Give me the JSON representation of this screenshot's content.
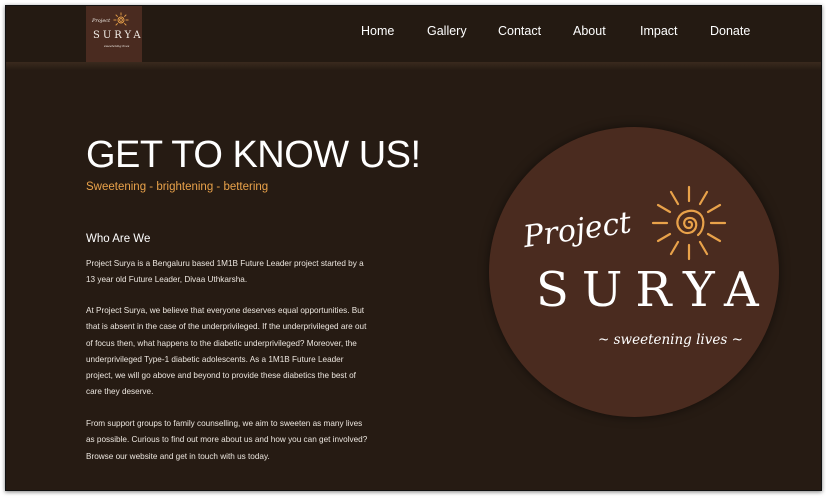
{
  "nav": {
    "logo": {
      "project": "Project",
      "surya": "SURYA",
      "tagline": "sweetening lives"
    },
    "items": [
      {
        "label": "Home"
      },
      {
        "label": "Gallery"
      },
      {
        "label": "Contact"
      },
      {
        "label": "About"
      },
      {
        "label": "Impact"
      },
      {
        "label": "Donate"
      }
    ]
  },
  "hero": {
    "title": "GET TO KNOW US!",
    "tagline": "Sweetening - brightening - bettering"
  },
  "about": {
    "heading": "Who Are We",
    "paragraphs": [
      "Project Surya is a Bengaluru based 1M1B Future Leader project started by a 13 year old Future Leader, Divaa Uthkarsha.",
      "At Project Surya, we believe that everyone deserves equal opportunities. But that is absent in the case of the underprivileged. If the underprivileged are out of focus then, what happens to the diabetic underprivileged? Moreover, the underprivileged Type-1 diabetic adolescents. As a 1M1B Future Leader project, we will go above and beyond to provide these diabetics the best of care they deserve.",
      "From support groups to family counselling, we aim to sweeten as many lives as possible. Curious to find out more about us and how you can get involved? Browse our website and get in touch with us today."
    ]
  },
  "emblem": {
    "project": "Project",
    "surya": "SURYA",
    "tagline": "~ sweetening lives ~"
  },
  "colors": {
    "background": "#261b13",
    "navbar": "#241a12",
    "accent": "#e9a24a",
    "circle": "#4a2b1f"
  },
  "icons": {
    "logo": "sun-spiral-icon"
  }
}
